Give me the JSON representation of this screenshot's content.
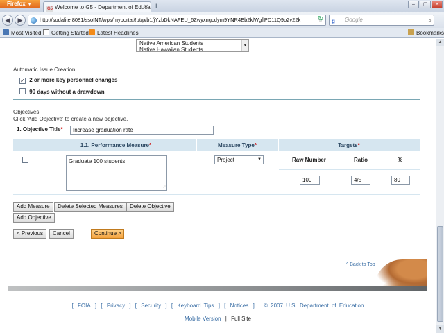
{
  "browser": {
    "app_button": "Firefox",
    "tab_title": "Welcome to G5 - Department of Educatio...",
    "favicon_text": "G5",
    "url": "http://sodalite:8081/ssoINT/wps/myportal/!ut/p/b1/jYzbDkNAFEU_6Zwyxngcdym9YNR4Eb2klWgflPD11Q9o2v22k",
    "search_placeholder": "Google",
    "bookmarks": [
      "Most Visited",
      "Getting Started",
      "Latest Headlines"
    ],
    "bookmarks_menu": "Bookmarks"
  },
  "list": {
    "items": [
      "Native American Students",
      "Native Hawaiian Students"
    ]
  },
  "issue_creation": {
    "heading": "Automatic Issue Creation",
    "options": [
      {
        "label": "2 or more key personnel changes",
        "checked": true
      },
      {
        "label": "90 days without a drawdown",
        "checked": false
      }
    ]
  },
  "objectives": {
    "heading": "Objectives",
    "instruction": "Click 'Add Objective' to create a new objective.",
    "title_label": "1. Objective Title",
    "required_mark": "*",
    "title_value": "Increase graduation rate"
  },
  "table": {
    "col_measure": "1.1. Performance Measure",
    "col_type": "Measure Type",
    "col_targets": "Targets",
    "measure_text": "Graduate 100 students",
    "type_value": "Project",
    "target_headers": [
      "Raw Number",
      "Ratio",
      "%"
    ],
    "target_values": [
      "100",
      "4/5",
      "80"
    ]
  },
  "buttons": {
    "add_measure": "Add Measure",
    "delete_selected": "Delete Selected Measures",
    "delete_objective": "Delete Objective",
    "add_objective": "Add Objective",
    "previous": "< Previous",
    "cancel": "Cancel",
    "continue": "Continue >"
  },
  "footer": {
    "back_to_top": "^ Back to Top",
    "links": [
      "FOIA",
      "Privacy",
      "Security",
      "Keyboard Tips",
      "Notices"
    ],
    "copyright": "© 2007 U.S. Department of Education",
    "mobile_version": "Mobile Version",
    "separator": "|",
    "full_site": "Full Site"
  }
}
